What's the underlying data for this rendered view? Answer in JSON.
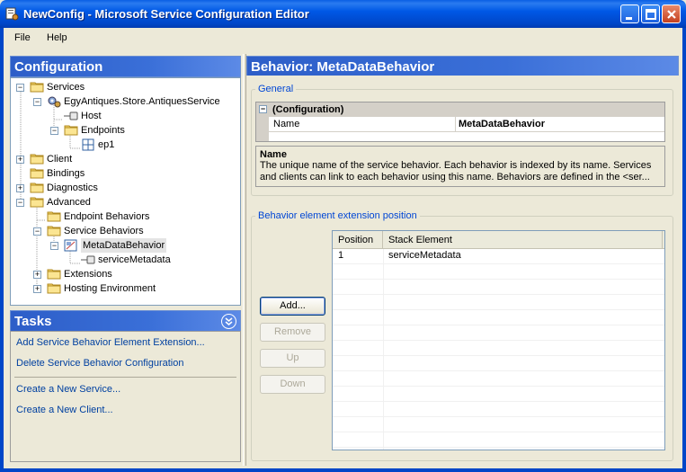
{
  "window": {
    "title": "NewConfig - Microsoft Service Configuration Editor"
  },
  "menu": [
    "File",
    "Help"
  ],
  "configuration_panel": {
    "title": "Configuration",
    "tree": [
      {
        "label": "Services",
        "level": 0,
        "expander": "−",
        "icon": "folder-icon"
      },
      {
        "label": "EgyAntiques.Store.AntiquesService",
        "level": 1,
        "expander": "−",
        "icon": "service-icon"
      },
      {
        "label": "Host",
        "level": 2,
        "expander": "",
        "icon": "host-icon"
      },
      {
        "label": "Endpoints",
        "level": 2,
        "expander": "−",
        "icon": "folder-icon"
      },
      {
        "label": "ep1",
        "level": 3,
        "expander": "",
        "icon": "endpoint-icon"
      },
      {
        "label": "Client",
        "level": 0,
        "expander": "+",
        "icon": "folder-icon"
      },
      {
        "label": "Bindings",
        "level": 0,
        "expander": "",
        "icon": "folder-icon"
      },
      {
        "label": "Diagnostics",
        "level": 0,
        "expander": "+",
        "icon": "folder-icon"
      },
      {
        "label": "Advanced",
        "level": 0,
        "expander": "−",
        "icon": "folder-icon"
      },
      {
        "label": "Endpoint Behaviors",
        "level": 1,
        "expander": "",
        "icon": "folder-icon"
      },
      {
        "label": "Service Behaviors",
        "level": 1,
        "expander": "−",
        "icon": "folder-icon"
      },
      {
        "label": "MetaDataBehavior",
        "level": 2,
        "expander": "−",
        "icon": "behavior-icon",
        "selected": true
      },
      {
        "label": "serviceMetadata",
        "level": 3,
        "expander": "",
        "icon": "element-icon"
      },
      {
        "label": "Extensions",
        "level": 1,
        "expander": "+",
        "icon": "folder-icon"
      },
      {
        "label": "Hosting Environment",
        "level": 1,
        "expander": "+",
        "icon": "folder-icon"
      }
    ]
  },
  "tasks_panel": {
    "title": "Tasks",
    "links": [
      "Add Service Behavior Element Extension...",
      "Delete Service Behavior Configuration",
      "Create a New Service...",
      "Create a New Client..."
    ]
  },
  "main": {
    "header": "Behavior: MetaDataBehavior",
    "general": {
      "title": "General",
      "category": "(Configuration)",
      "property_name": "Name",
      "property_value": "MetaDataBehavior",
      "description_title": "Name",
      "description_text": "The unique name of the service behavior. Each behavior is indexed by its name. Services and clients can link to each behavior using this name. Behaviors are defined in the <ser..."
    },
    "extension": {
      "title": "Behavior element extension position",
      "buttons": {
        "add": "Add...",
        "remove": "Remove",
        "up": "Up",
        "down": "Down"
      },
      "columns": [
        "Position",
        "Stack Element"
      ],
      "rows": [
        {
          "position": "1",
          "element": "serviceMetadata"
        }
      ]
    }
  },
  "colors": {
    "title_bar": "#0058e6",
    "panel_header": "#3a6fd8",
    "link": "#0040a0",
    "group_title": "#0046d5"
  }
}
